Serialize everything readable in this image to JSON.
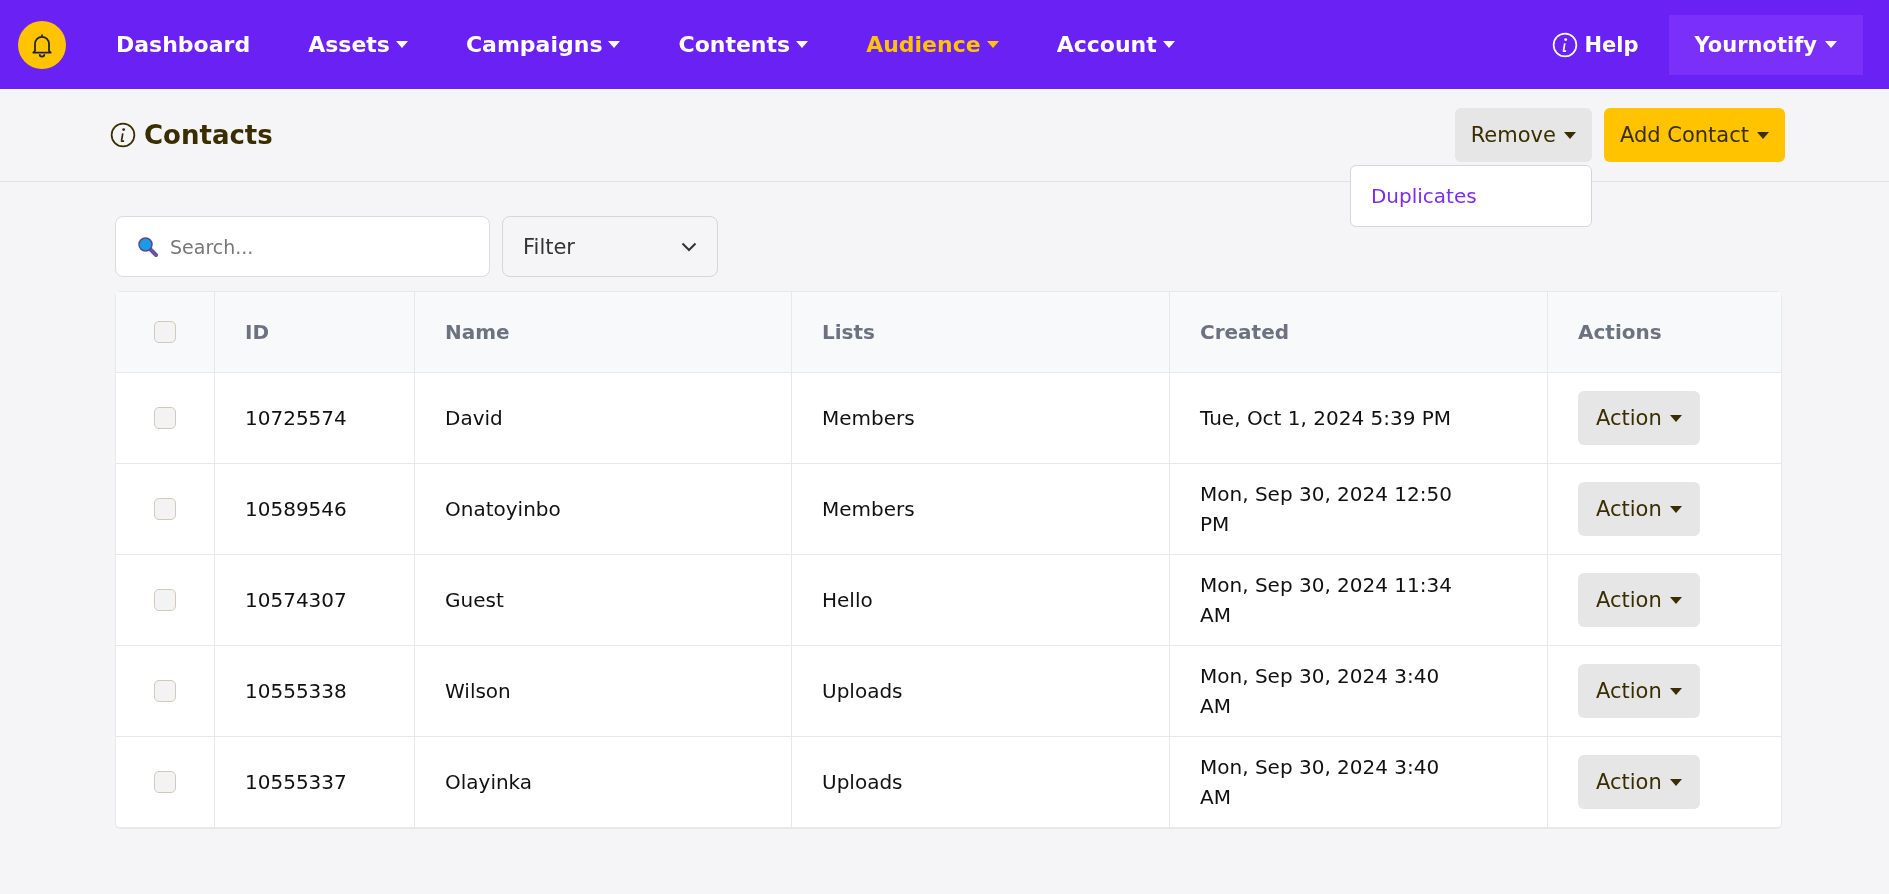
{
  "nav": {
    "items": [
      {
        "label": "Dashboard",
        "has_caret": false,
        "selected": false
      },
      {
        "label": "Assets",
        "has_caret": true,
        "selected": false
      },
      {
        "label": "Campaigns",
        "has_caret": true,
        "selected": false
      },
      {
        "label": "Contents",
        "has_caret": true,
        "selected": false
      },
      {
        "label": "Audience",
        "has_caret": true,
        "selected": true
      },
      {
        "label": "Account",
        "has_caret": true,
        "selected": false
      }
    ],
    "help": "Help",
    "account": "Yournotify"
  },
  "page": {
    "title": "Contacts",
    "remove_button": "Remove",
    "add_button": "Add Contact",
    "remove_menu": {
      "expanded": true,
      "items": [
        "Duplicates"
      ]
    }
  },
  "toolbar": {
    "search": {
      "placeholder": "Search..."
    },
    "filter": {
      "value": "Filter"
    }
  },
  "table": {
    "select_all_checked": false,
    "columns": [
      "ID",
      "Name",
      "Lists",
      "Created",
      "Actions"
    ],
    "rows": [
      {
        "checked": false,
        "id": "10725574",
        "name": "David",
        "list": "Members",
        "created": "Tue, Oct 1, 2024 5:39 PM",
        "action": "Action"
      },
      {
        "checked": false,
        "id": "10589546",
        "name": "Onatoyinbo",
        "list": "Members",
        "created": "Mon, Sep 30, 2024 12:50 PM",
        "action": "Action"
      },
      {
        "checked": false,
        "id": "10574307",
        "name": "Guest",
        "list": "Hello",
        "created": "Mon, Sep 30, 2024 11:34 AM",
        "action": "Action"
      },
      {
        "checked": false,
        "id": "10555338",
        "name": "Wilson",
        "list": "Uploads",
        "created": "Mon, Sep 30, 2024 3:40 AM",
        "action": "Action"
      },
      {
        "checked": false,
        "id": "10555337",
        "name": "Olayinka",
        "list": "Uploads",
        "created": "Mon, Sep 30, 2024 3:40 AM",
        "action": "Action"
      }
    ]
  }
}
